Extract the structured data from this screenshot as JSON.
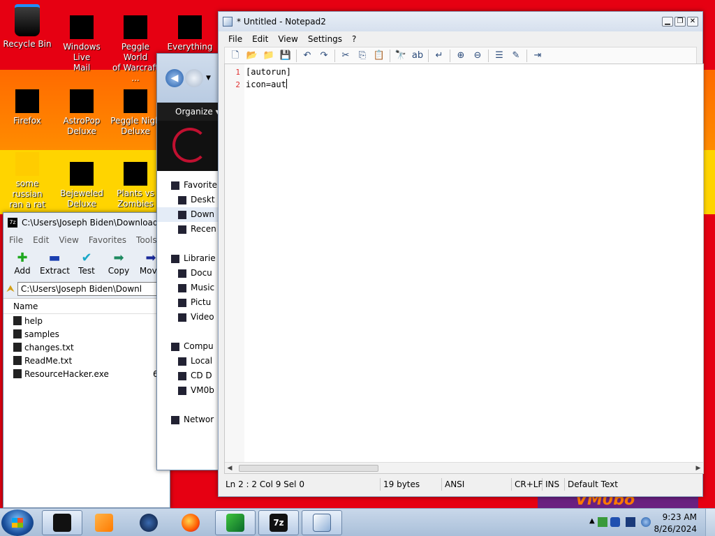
{
  "desktop": {
    "icons": [
      {
        "label_l1": "Recycle Bin",
        "label_l2": ""
      },
      {
        "label_l1": "Windows Live",
        "label_l2": "Mail"
      },
      {
        "label_l1": "Peggle World",
        "label_l2": "of Warcraft ..."
      },
      {
        "label_l1": "Everything",
        "label_l2": ""
      },
      {
        "label_l1": "Firefox",
        "label_l2": ""
      },
      {
        "label_l1": "AstroPop",
        "label_l2": "Deluxe"
      },
      {
        "label_l1": "Peggle Nigh",
        "label_l2": "Deluxe"
      },
      {
        "label_l1": "some russian",
        "label_l2": "ran a rat"
      },
      {
        "label_l1": "Bejeweled",
        "label_l2": "Deluxe"
      },
      {
        "label_l1": "Plants vs",
        "label_l2": "Zombies"
      }
    ]
  },
  "zip": {
    "title": "C:\\Users\\Joseph Biden\\Downloads\\",
    "menu": [
      "File",
      "Edit",
      "View",
      "Favorites",
      "Tools"
    ],
    "toolbar": [
      "Add",
      "Extract",
      "Test",
      "Copy",
      "Move"
    ],
    "address": "C:\\Users\\Joseph Biden\\Downl",
    "col_name": "Name",
    "files": [
      "help",
      "samples",
      "changes.txt",
      "ReadMe.txt",
      "ResourceHacker.exe"
    ],
    "partial_size": "6"
  },
  "explorer": {
    "organize": "Organize ▾",
    "nav": [
      {
        "label": "Favorite",
        "kind": "grp"
      },
      {
        "label": "Deskt",
        "kind": "sub"
      },
      {
        "label": "Down",
        "kind": "sub",
        "selected": true
      },
      {
        "label": "Recen",
        "kind": "sub"
      },
      {
        "label": "",
        "kind": "gap"
      },
      {
        "label": "Librarie",
        "kind": "grp"
      },
      {
        "label": "Docu",
        "kind": "sub"
      },
      {
        "label": "Music",
        "kind": "sub"
      },
      {
        "label": "Pictu",
        "kind": "sub"
      },
      {
        "label": "Video",
        "kind": "sub"
      },
      {
        "label": "",
        "kind": "gap"
      },
      {
        "label": "Compu",
        "kind": "grp"
      },
      {
        "label": "Local",
        "kind": "sub"
      },
      {
        "label": "CD D",
        "kind": "sub"
      },
      {
        "label": "VM0b",
        "kind": "sub"
      },
      {
        "label": "",
        "kind": "gap"
      },
      {
        "label": "Networ",
        "kind": "grp"
      }
    ]
  },
  "notepad": {
    "title": "* Untitled - Notepad2",
    "menu": [
      "File",
      "Edit",
      "View",
      "Settings",
      "?"
    ],
    "lines": [
      {
        "num": "1",
        "text": "[autorun]"
      },
      {
        "num": "2",
        "text": "icon=aut"
      }
    ],
    "status": {
      "pos": "Ln 2 : 2   Col 9   Sel 0",
      "size": "19 bytes",
      "encoding": "ANSI",
      "eol": "CR+LF",
      "ins": "INS",
      "scheme": "Default Text"
    }
  },
  "vmob_text": "VM0bo",
  "taskbar": {
    "time": "9:23 AM",
    "date": "8/26/2024"
  }
}
